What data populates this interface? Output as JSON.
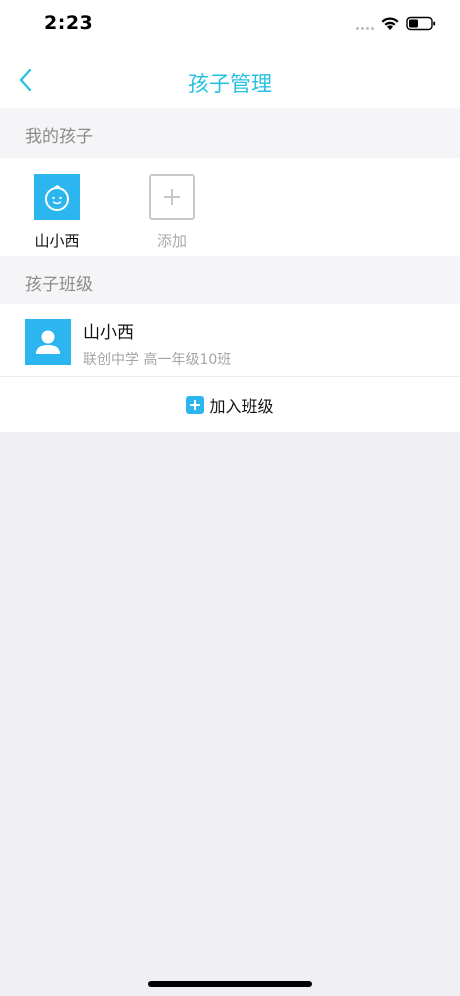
{
  "status_bar": {
    "time": "2:23"
  },
  "nav": {
    "title": "孩子管理",
    "accent_color": "#26c0e0"
  },
  "sections": {
    "my_children": "我的孩子",
    "children_classes": "孩子班级"
  },
  "children": [
    {
      "name": "山小西",
      "avatar_icon": "child-face-icon"
    }
  ],
  "add_child": {
    "label": "添加",
    "icon": "plus-icon"
  },
  "classes": [
    {
      "student_name": "山小西",
      "info": "联创中学 高一年级10班",
      "avatar_icon": "person-avatar-icon"
    }
  ],
  "join_class": {
    "label": "加入班级",
    "icon": "plus-square-icon"
  },
  "colors": {
    "brand_blue": "#2bb6f0",
    "background": "#efeff4"
  }
}
